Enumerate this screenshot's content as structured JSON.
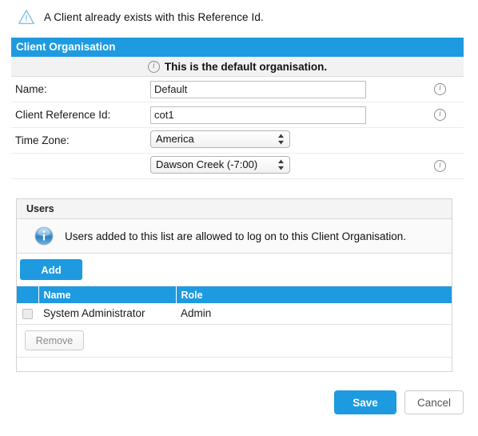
{
  "warning": {
    "icon": "warning-triangle-icon",
    "message": "A Client already exists with this Reference Id."
  },
  "client_organisation": {
    "header_title": "Client Organisation",
    "default_note": {
      "icon": "info-circle-icon",
      "text": "This is the default organisation."
    },
    "fields": [
      {
        "label": "Name:",
        "value": "Default",
        "info_icon": "info-circle-icon"
      },
      {
        "label": "Client Reference Id:",
        "value": "cot1",
        "info_icon": "info-circle-icon"
      }
    ],
    "time_zone": {
      "label": "Time Zone:",
      "region_selected": "America",
      "city_selected": "Dawson Creek (-7:00)",
      "info_icon": "info-circle-icon"
    }
  },
  "users": {
    "header_title": "Users",
    "note": {
      "icon": "info-glossy-icon",
      "text": "Users added to this list are allowed to log on to this Client Organisation."
    },
    "add_label": "Add",
    "remove_label": "Remove",
    "columns": [
      "",
      "Name",
      "Role"
    ],
    "rows": [
      {
        "checked": false,
        "name": "System Administrator",
        "role": "Admin"
      }
    ]
  },
  "footer": {
    "save_label": "Save",
    "cancel_label": "Cancel"
  },
  "colors": {
    "accent_blue": "#1e9ae0",
    "header_text": "#ffffff",
    "warning_stroke": "#7fc4e8",
    "panel_border": "#d4d4d4"
  }
}
